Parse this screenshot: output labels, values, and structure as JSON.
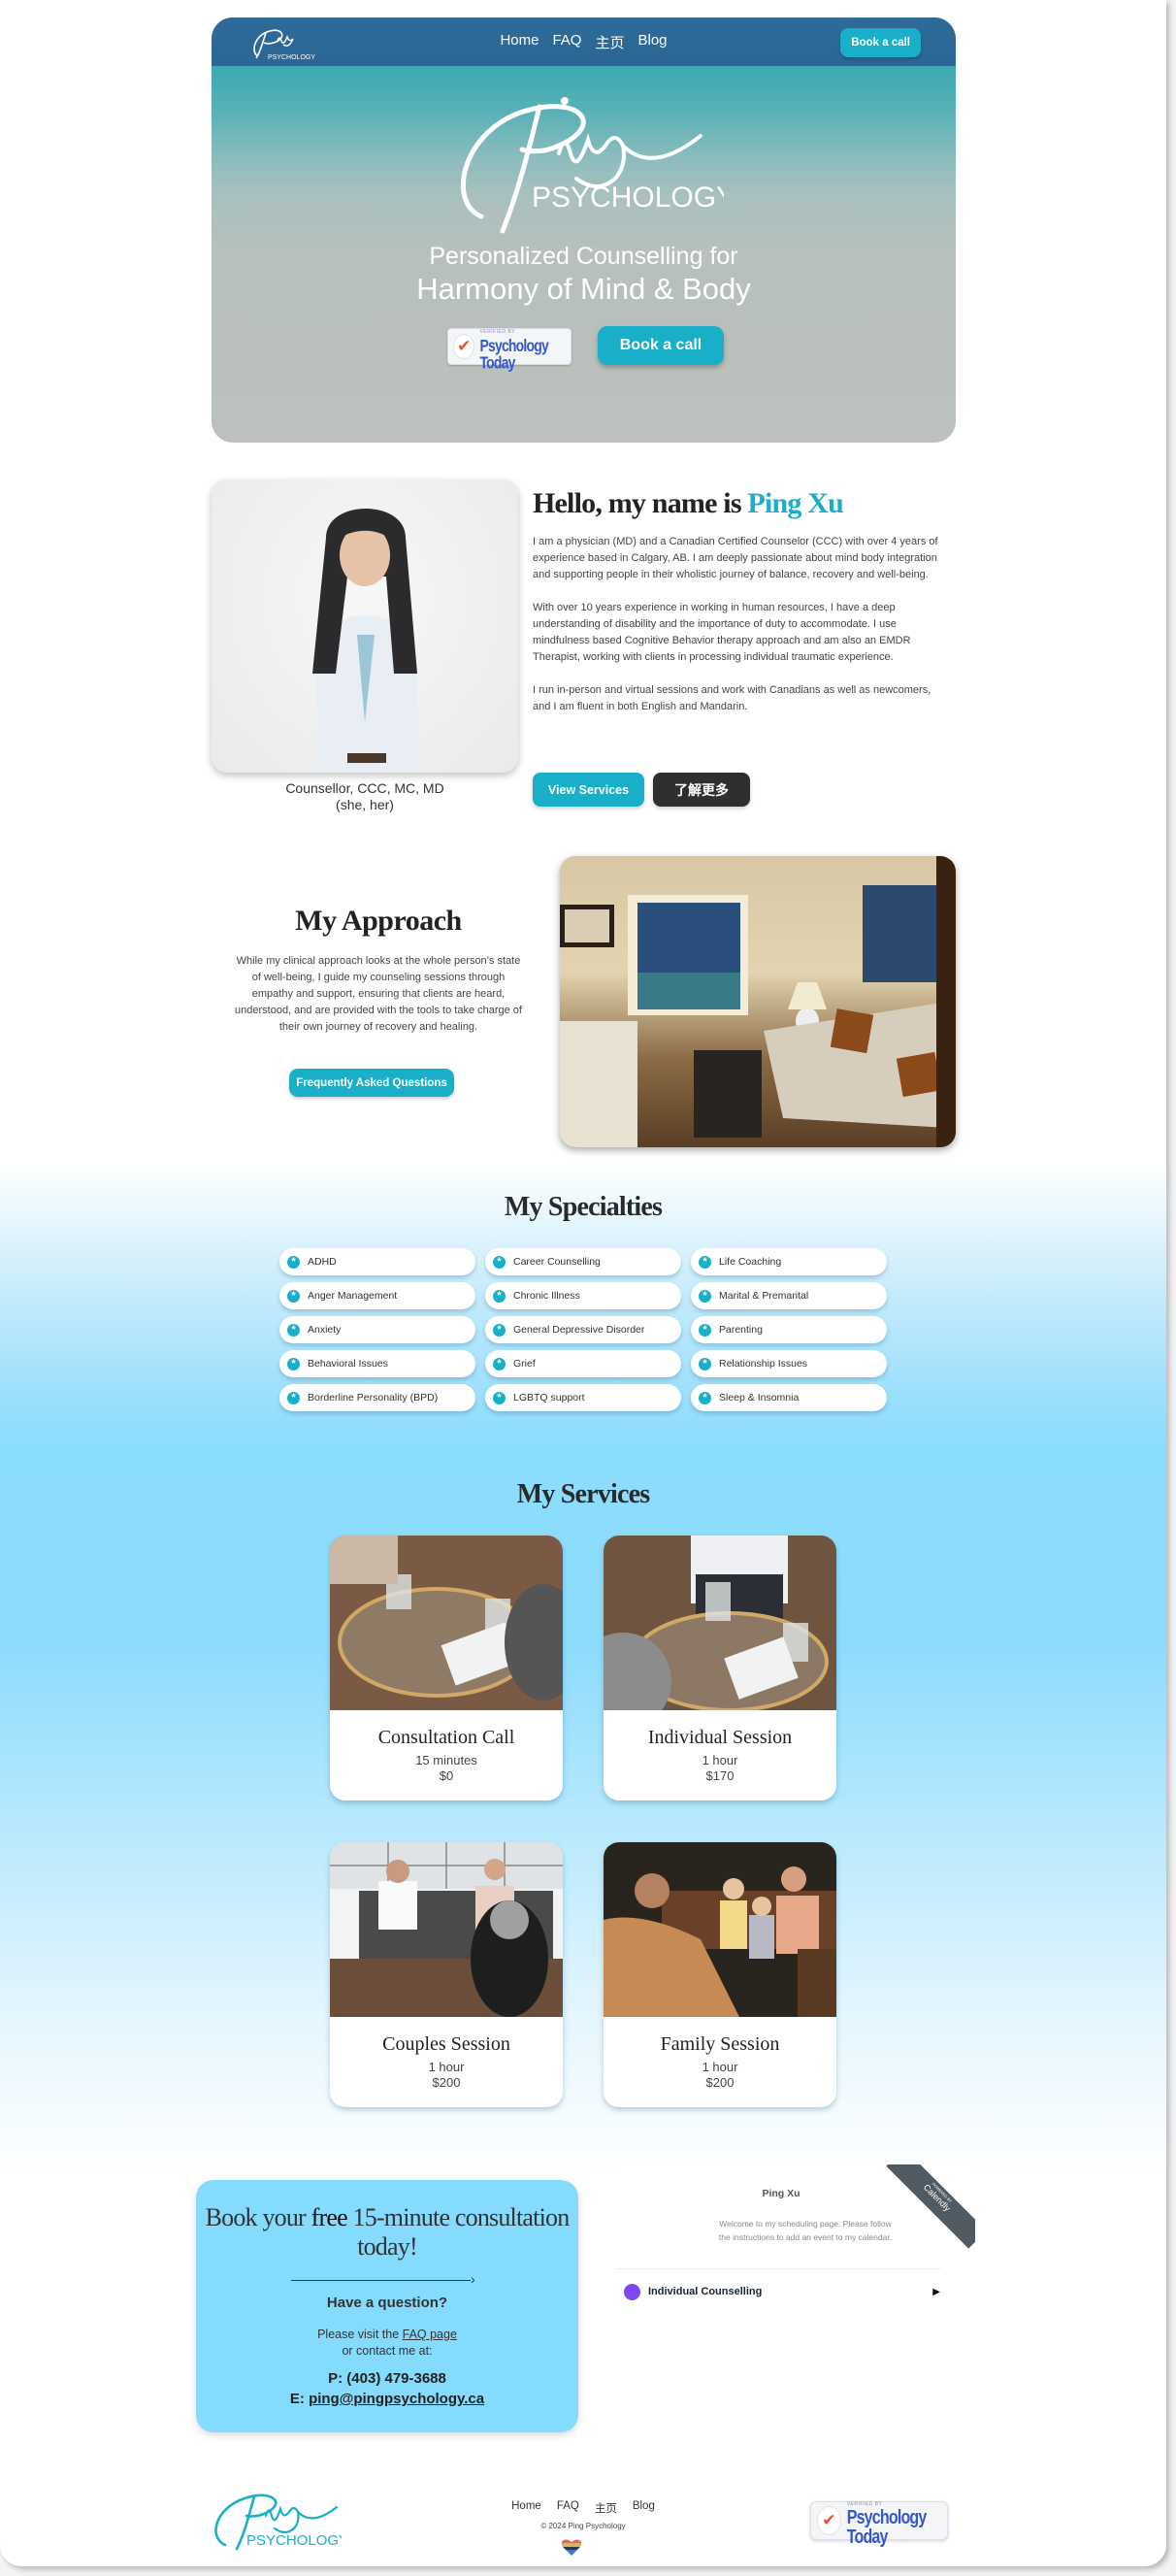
{
  "nav": {
    "logo_alt": "Ping Psychology",
    "links": [
      "Home",
      "FAQ",
      "主页",
      "Blog"
    ],
    "book_label": "Book a call"
  },
  "hero": {
    "logo_script": "Ping",
    "logo_word": "PSYCHOLOGY",
    "tagline_line1": "Personalized Counselling for",
    "tagline_line2": "Harmony of Mind & Body",
    "badge_small": "VERIFIED BY",
    "badge_big": "Psychology Today",
    "book_label": "Book a call"
  },
  "about": {
    "greeting": "Hello, my name is ",
    "name": "Ping Xu",
    "paragraphs": [
      "I am a physician (MD) and a Canadian Certified Counselor (CCC) with over 4 years of experience based in Calgary, AB. I am deeply passionate about mind body integration and supporting people in their wholistic journey of balance, recovery and well-being.",
      "With over 10 years experience in working in human resources, I have a deep understanding of disability and the importance of duty to accommodate. I use mindfulness based Cognitive Behavior therapy approach and am also an EMDR Therapist, working with clients in processing individual traumatic experience.",
      "I run in-person and virtual sessions and work with Canadians as well as newcomers, and I am fluent in both English and Mandarin."
    ],
    "caption_line1": "Counsellor, CCC, MC, MD",
    "caption_line2": "(she, her)",
    "view_services_label": "View Services",
    "learn_more_label": "了解更多"
  },
  "approach": {
    "title": "My Approach",
    "text": "While my clinical approach looks at the whole person’s state of well-being, I guide my counseling sessions through empathy and support, ensuring that clients are heard, understood, and are provided with the tools to take charge of their own journey of recovery and healing.",
    "faq_label": "Frequently Asked Questions"
  },
  "specialties": {
    "title": "My Specialties",
    "items": [
      "ADHD",
      "Career Counselling",
      "Life Coaching",
      "Anger Management",
      "Chronic Illness",
      "Marital & Premarital",
      "Anxiety",
      "General Depressive Disorder",
      "Parenting",
      "Behavioral Issues",
      "Grief",
      "Relationship Issues",
      "Borderline Personality (BPD)",
      "LGBTQ support",
      "Sleep & Insomnia"
    ]
  },
  "services": {
    "title": "My Services",
    "items": [
      {
        "title": "Consultation Call",
        "duration": "15 minutes",
        "price": "$0"
      },
      {
        "title": "Individual Session",
        "duration": "1 hour",
        "price": "$170"
      },
      {
        "title": "Couples Session",
        "duration": "1 hour",
        "price": "$200"
      },
      {
        "title": "Family Session",
        "duration": "1 hour",
        "price": "$200"
      }
    ]
  },
  "booking": {
    "title_pre": "Book your ",
    "title_free": "free",
    "title_post": " 15-minute consultation today!",
    "arrow": "›",
    "question": "Have a question?",
    "visit_pre": "Please visit the ",
    "faq_link": "FAQ page",
    "visit_post": "or contact me at:",
    "phone": "P: (403) 479-3688",
    "email_prefix": "E: ",
    "email": "ping@pingpsychology.ca"
  },
  "calendly": {
    "ribbon_small": "POWERED BY",
    "ribbon": "Calendly",
    "name": "Ping Xu",
    "description": "Welcome to my scheduling page. Please follow the instructions to add an event to my calendar.",
    "event_name": "Individual Counselling",
    "event_color": "#8247f5"
  },
  "footer": {
    "links": [
      "Home",
      "FAQ",
      "主页",
      "Blog"
    ],
    "copyright": "© 2024 Ping Psychology",
    "badge_small": "VERIFIED BY",
    "badge_big": "Psychology Today"
  },
  "colors": {
    "accent": "#19afc8",
    "nav_bg": "#2f6b98",
    "light_blue": "#84dbfd",
    "dark_button": "#2f2f2f"
  }
}
